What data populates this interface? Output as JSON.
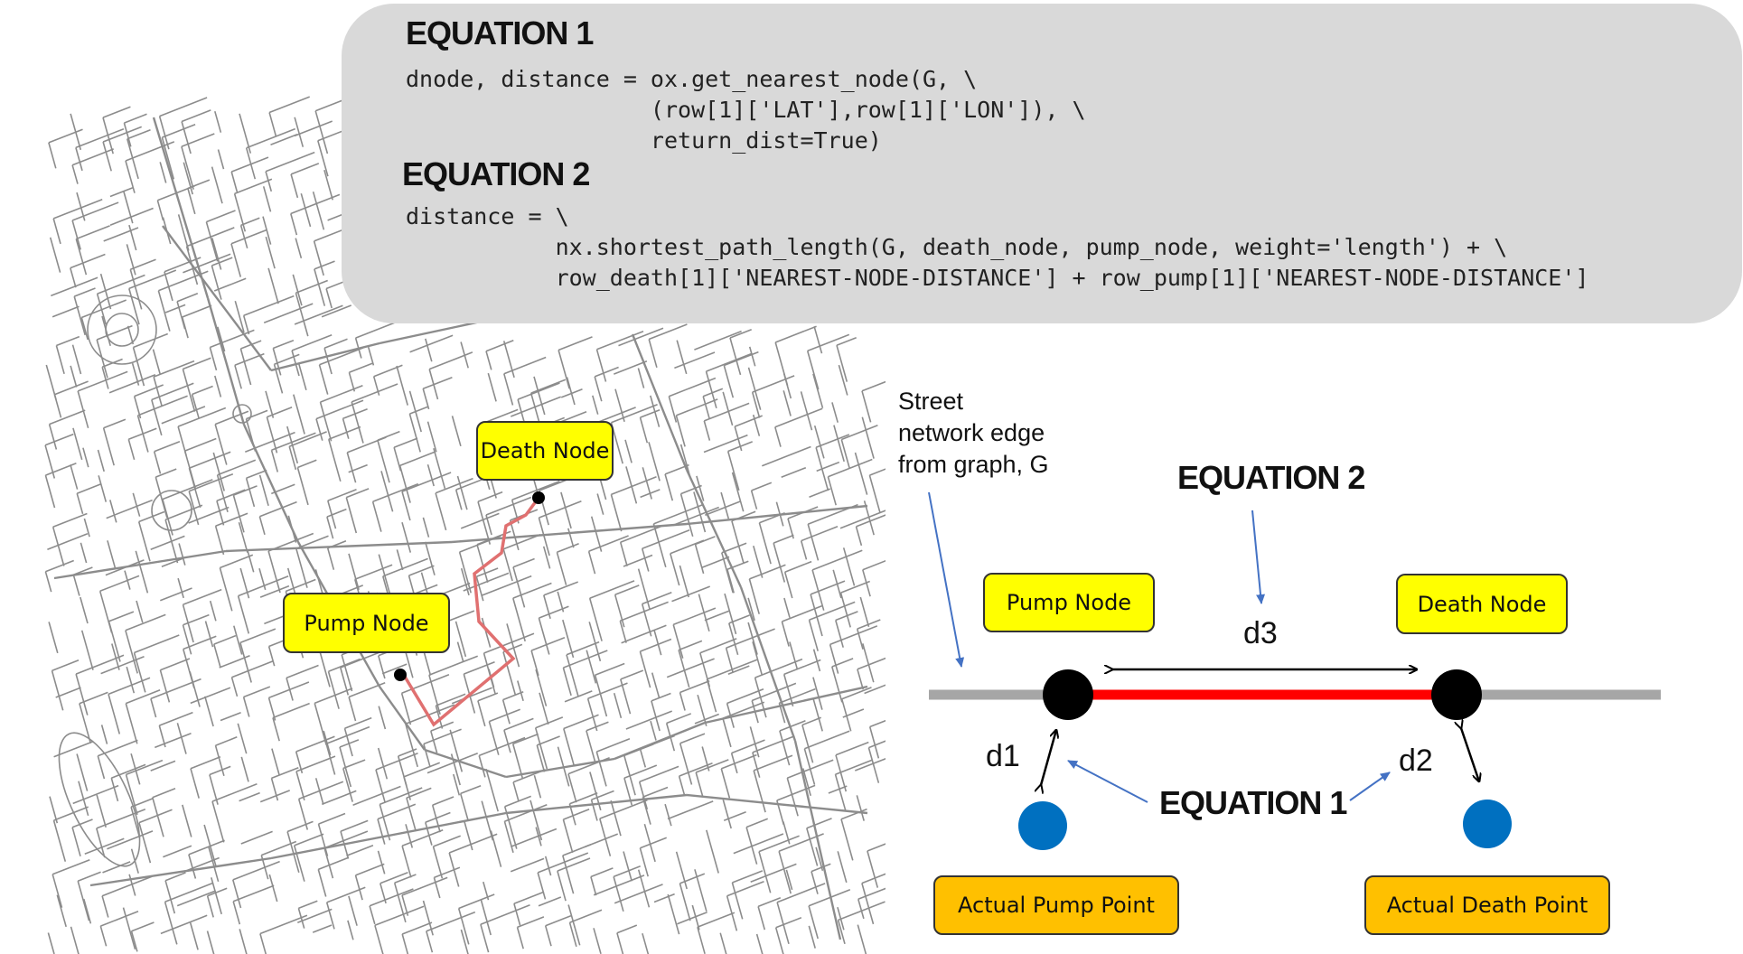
{
  "code_panel": {
    "equation1_title": "EQUATION 1",
    "equation1_code": "dnode, distance = ox.get_nearest_node(G, \\\n                  (row[1]['LAT'],row[1]['LON']), \\\n                  return_dist=True)",
    "equation2_title": "EQUATION 2",
    "equation2_code": "distance = \\\n           nx.shortest_path_length(G, death_node, pump_node, weight='length') + \\\n           row_death[1]['NEAREST-NODE-DISTANCE'] + row_pump[1]['NEAREST-NODE-DISTANCE']"
  },
  "map": {
    "death_node_label": "Death Node",
    "pump_node_label": "Pump Node",
    "path_color": "#e07070"
  },
  "diagram": {
    "street_label": "Street\nnetwork edge\nfrom graph, G",
    "equation2_label": "EQUATION 2",
    "equation1_label": "EQUATION 1",
    "pump_node_label": "Pump Node",
    "death_node_label": "Death Node",
    "actual_pump_label": "Actual Pump Point",
    "actual_death_label": "Actual Death Point",
    "d1": "d1",
    "d2": "d2",
    "d3": "d3",
    "edge_color": "#a6a6a6",
    "path_color": "#ff0000",
    "node_color": "#000000",
    "point_color": "#0070c0",
    "arrow_color": "#4472c4"
  }
}
